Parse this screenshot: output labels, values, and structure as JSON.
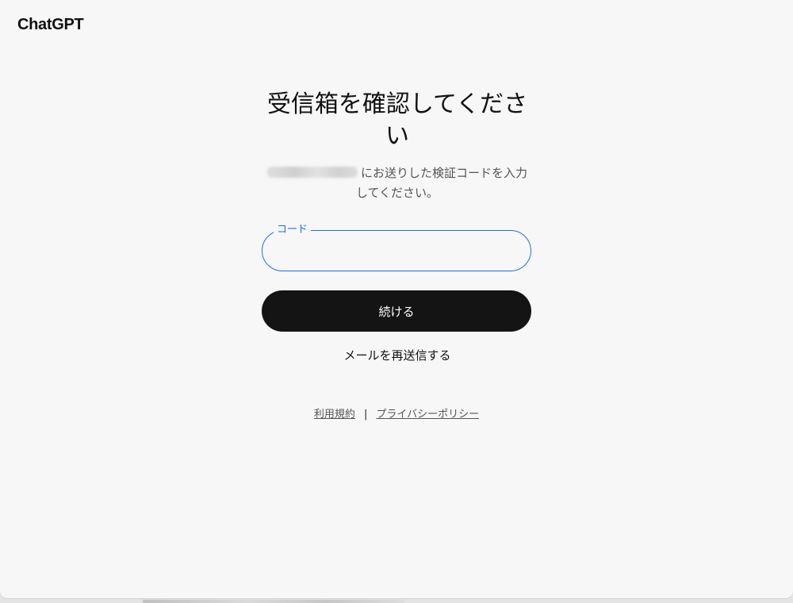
{
  "brand": {
    "logo_text": "ChatGPT"
  },
  "verify": {
    "title": "受信箱を確認してください",
    "subtitle": "にお送りした検証コードを入力してください。",
    "code_label": "コード",
    "code_value": "",
    "continue_label": "続ける",
    "resend_label": "メールを再送信する"
  },
  "footer": {
    "terms_label": "利用規約",
    "separator": "|",
    "privacy_label": "プライバシーポリシー"
  },
  "colors": {
    "accent": "#1f6feb",
    "button_bg": "#141414",
    "page_bg": "#f7f7f7"
  }
}
